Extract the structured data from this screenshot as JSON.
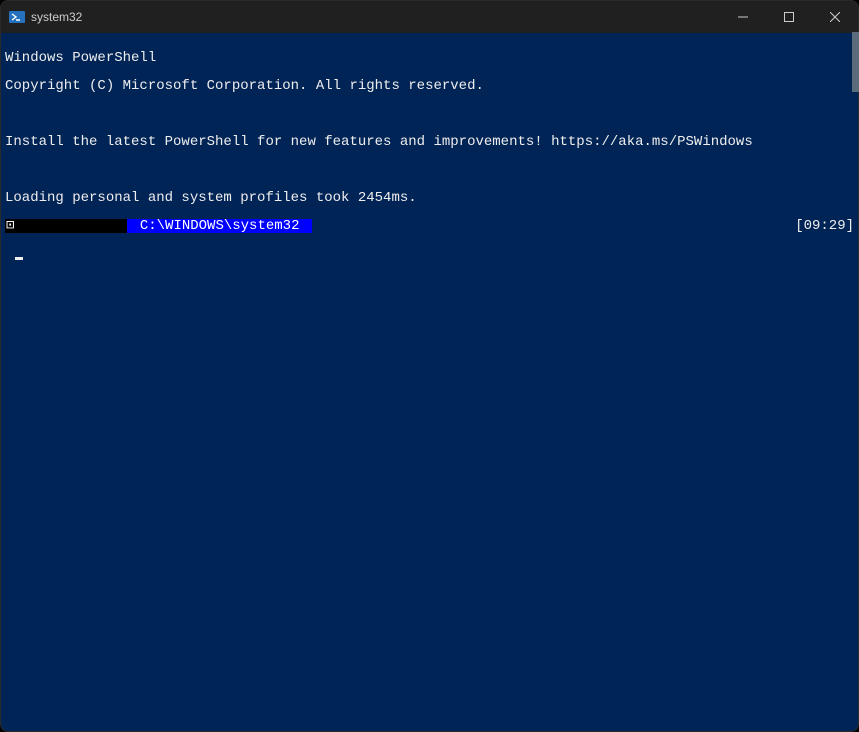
{
  "window": {
    "title": "system32"
  },
  "terminal": {
    "line1": "Windows PowerShell",
    "line2": "Copyright (C) Microsoft Corporation. All rights reserved.",
    "line3": "Install the latest PowerShell for new features and improvements! https://aka.ms/PSWindows",
    "line4": "Loading personal and system profiles took 2454ms.",
    "prompt": {
      "glyph": "⊡",
      "path": " C:\\WINDOWS\\system32 ",
      "time": "[09:29]"
    }
  }
}
